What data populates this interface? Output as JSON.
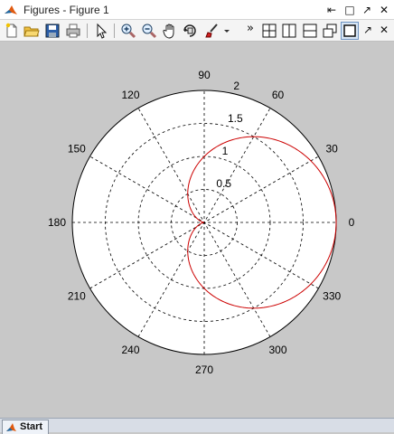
{
  "window": {
    "title": "Figures - Figure 1"
  },
  "titlebar_buttons": [
    "⇤",
    "□",
    "↗",
    "✕"
  ],
  "toolbar": {
    "icons": [
      "new-figure",
      "open-file",
      "save",
      "print",
      "edit-plot-arrow",
      "zoom-in",
      "zoom-out",
      "pan",
      "rotate-3d",
      "data-cursor",
      "brush",
      "dropdown",
      "more",
      "tile-grid",
      "tile-columns",
      "tile-rows",
      "float",
      "maximize",
      "dock",
      "close"
    ],
    "more_label": "»",
    "dock_label": "↗",
    "close_label": "✕"
  },
  "chart_data": {
    "type": "polar",
    "title": "",
    "rmax": 2,
    "radial_ticks": [
      {
        "value": 0.5,
        "label": "0.5"
      },
      {
        "value": 1,
        "label": "1"
      },
      {
        "value": 1.5,
        "label": "1.5"
      },
      {
        "value": 2,
        "label": "2"
      }
    ],
    "angle_ticks": [
      0,
      30,
      60,
      90,
      120,
      150,
      180,
      210,
      240,
      270,
      300,
      330
    ],
    "angle_labels": [
      "0",
      "30",
      "60",
      "90",
      "120",
      "150",
      "180",
      "210",
      "240",
      "270",
      "300",
      "330"
    ],
    "grid": true,
    "series": [
      {
        "formula": "r = 1 + cos(theta)",
        "color": "#cc0000"
      }
    ],
    "background": "#ffffff",
    "figure_background": "#c8c8c8"
  },
  "taskbar": {
    "start_label": "Start"
  }
}
